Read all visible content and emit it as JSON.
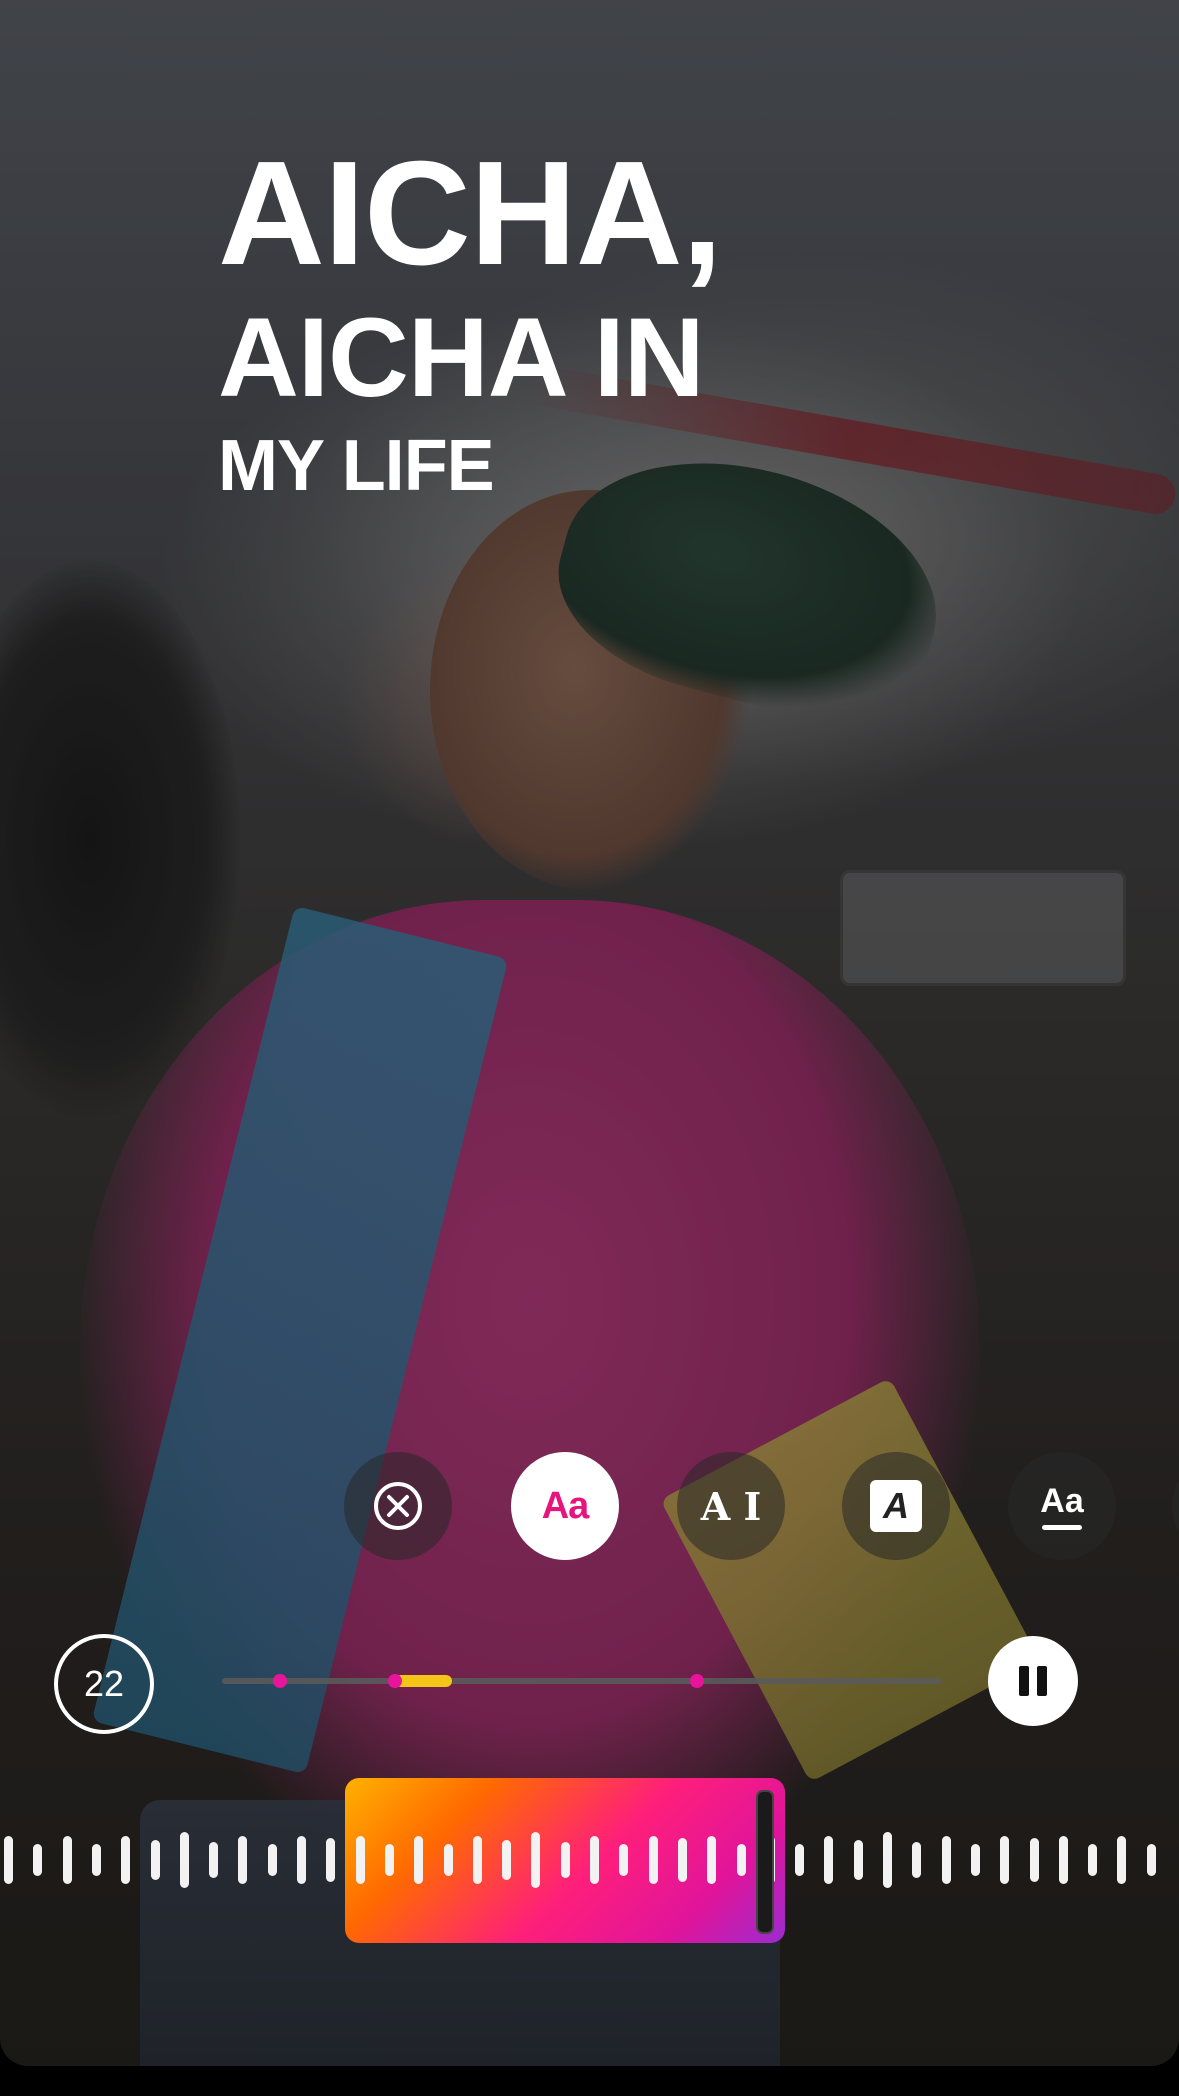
{
  "title": {
    "line1": "AICHA,",
    "line2": "AICHA IN",
    "line3": "MY LIFE"
  },
  "text_styles": [
    {
      "name": "none",
      "icon": "close-circle-icon",
      "selected": false
    },
    {
      "name": "classic",
      "label": "Aa",
      "selected": true
    },
    {
      "name": "typewriter",
      "label": "A I",
      "selected": false
    },
    {
      "name": "strong",
      "label": "A",
      "selected": false
    },
    {
      "name": "underline",
      "label": "Aa",
      "selected": false
    }
  ],
  "playback": {
    "duration_seconds": "22",
    "state": "playing",
    "playhead_fraction": 0.28,
    "selection_start_fraction": 0.24,
    "selection_end_fraction": 0.32,
    "marker_fractions": [
      0.08,
      0.24,
      0.66
    ]
  },
  "colors": {
    "accent_pink": "#e8147e",
    "accent_yellow": "#f5c518",
    "gradient": [
      "#ffb100",
      "#ff1f7a",
      "#9b2bd0"
    ]
  }
}
